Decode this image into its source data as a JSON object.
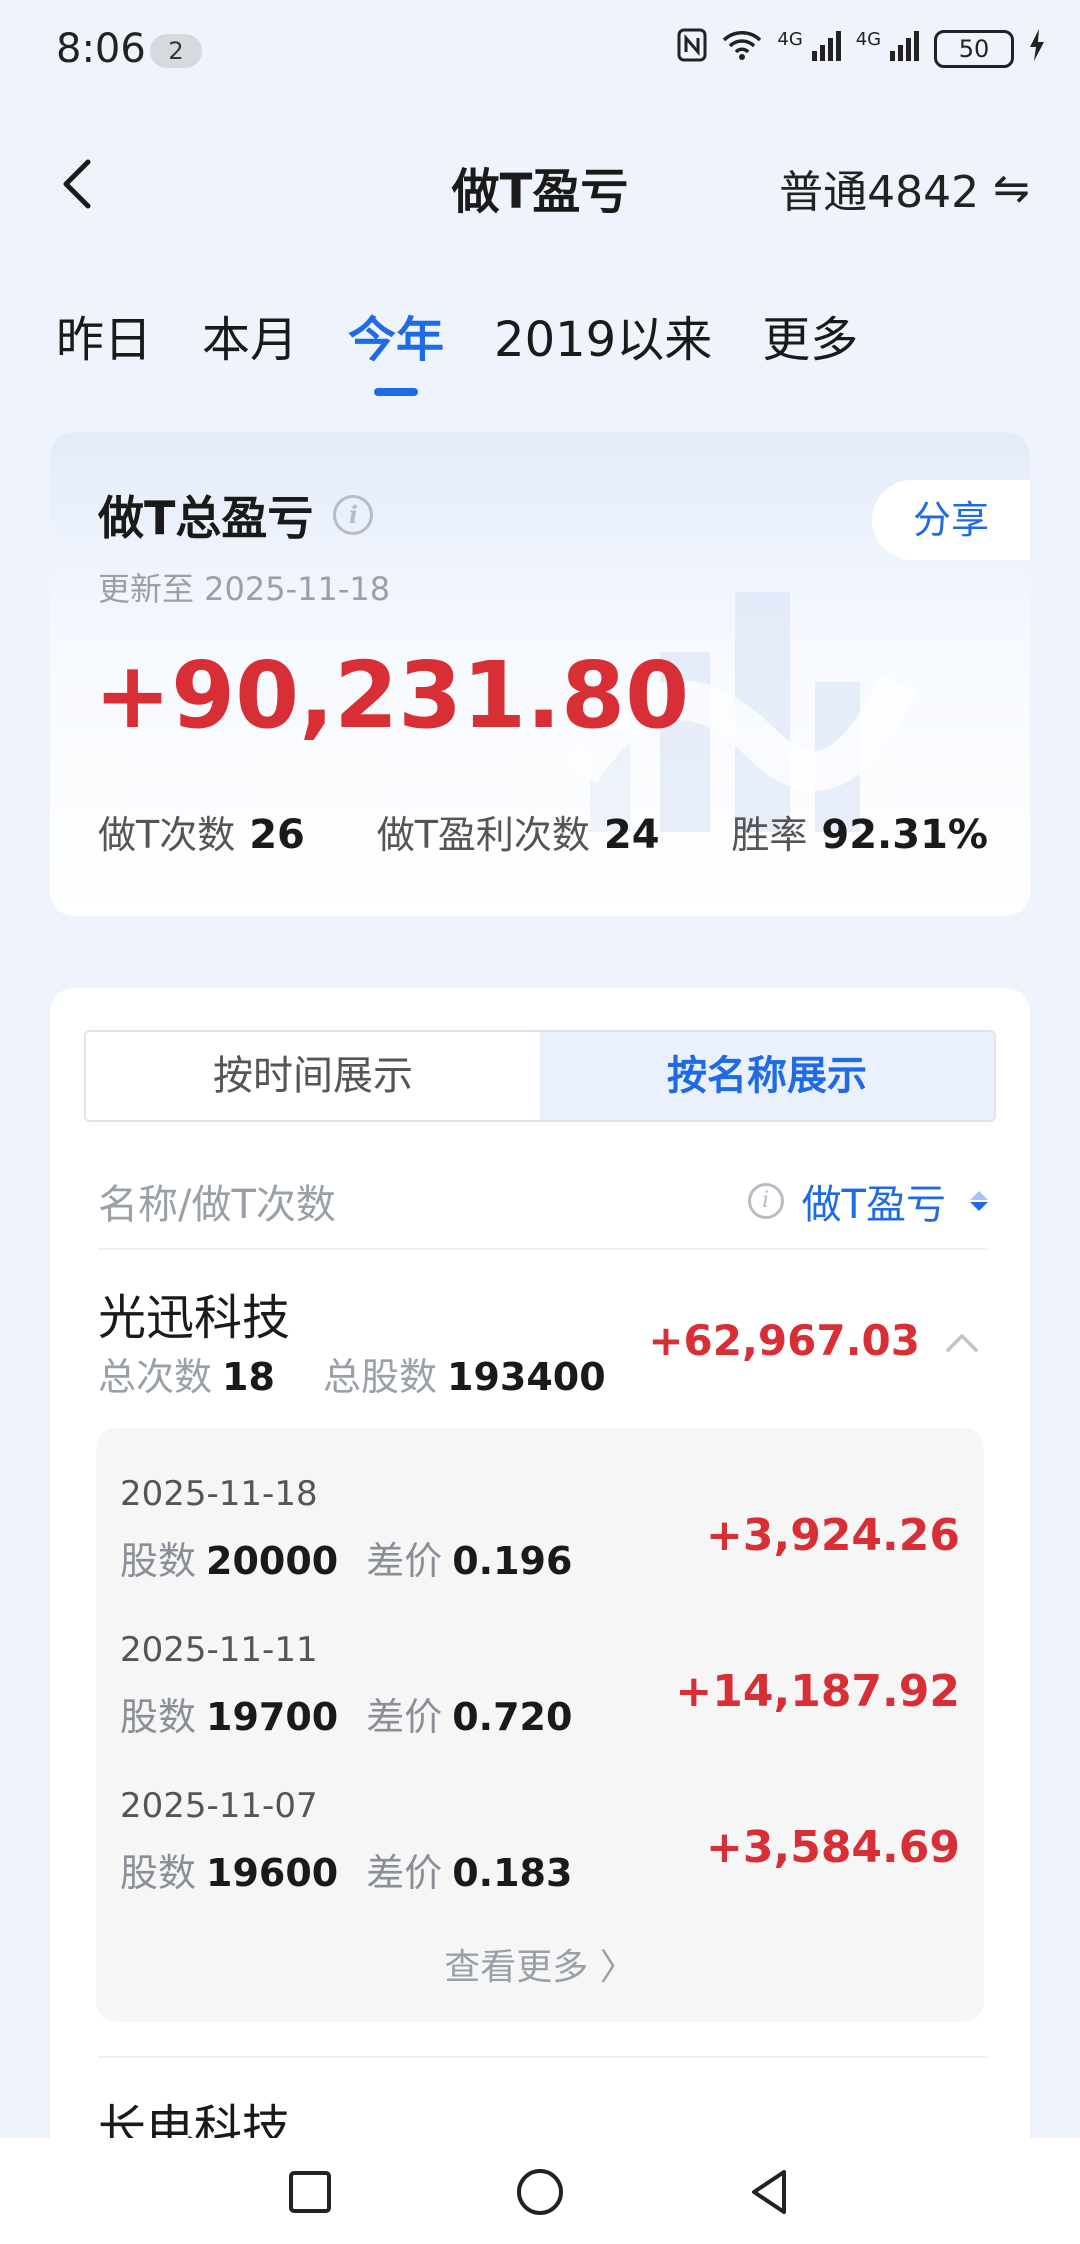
{
  "status": {
    "time": "8:06",
    "notif_count": "2",
    "network_1": "4G",
    "network_2": "4G",
    "battery": "50"
  },
  "header": {
    "title": "做T盈亏",
    "account": "普通4842",
    "switch_glyph": "⇋"
  },
  "tabs": [
    {
      "label": "昨日",
      "active": false
    },
    {
      "label": "本月",
      "active": false
    },
    {
      "label": "今年",
      "active": true
    },
    {
      "label": "2019以来",
      "active": false
    },
    {
      "label": "更多",
      "active": false
    }
  ],
  "summary": {
    "title": "做T总盈亏",
    "info_glyph": "i",
    "share_label": "分享",
    "updated": "更新至 2025-11-18",
    "total": "+90,231.80",
    "stats": [
      {
        "label": "做T次数",
        "value": "26"
      },
      {
        "label": "做T盈利次数",
        "value": "24"
      },
      {
        "label": "胜率",
        "value": "92.31%"
      }
    ]
  },
  "segmented": {
    "by_time": "按时间展示",
    "by_name": "按名称展示",
    "active": "by_name"
  },
  "list_header": {
    "left": "名称/做T次数",
    "right": "做T盈亏"
  },
  "stocks": [
    {
      "name": "光迅科技",
      "count_label": "总次数",
      "count": "18",
      "shares_label": "总股数",
      "shares": "193400",
      "pnl": "+62,967.03",
      "trades": [
        {
          "date": "2025-11-18",
          "shares_label": "股数",
          "shares": "20000",
          "diff_label": "差价",
          "diff": "0.196",
          "pnl": "+3,924.26"
        },
        {
          "date": "2025-11-11",
          "shares_label": "股数",
          "shares": "19700",
          "diff_label": "差价",
          "diff": "0.720",
          "pnl": "+14,187.92"
        },
        {
          "date": "2025-11-07",
          "shares_label": "股数",
          "shares": "19600",
          "diff_label": "差价",
          "diff": "0.183",
          "pnl": "+3,584.69"
        }
      ],
      "more_label": "查看更多 〉"
    },
    {
      "name": "长电科技",
      "pnl": ""
    }
  ],
  "colors": {
    "accent": "#1f6be6",
    "profit": "#d72f35",
    "background": "#eff4fc"
  }
}
